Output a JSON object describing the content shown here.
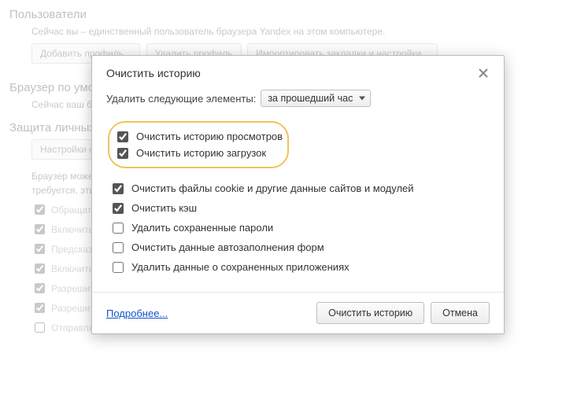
{
  "bg": {
    "users_heading": "Пользователи",
    "users_desc": "Сейчас вы – единственный пользователь браузера Yandex на этом компьютере.",
    "add_profile": "Добавить профиль...",
    "del_profile": "Удалить профиль",
    "import": "Импортировать закладки и настройки...",
    "default_heading": "Браузер по умолчанию",
    "default_desc": "Сейчас ваш бр",
    "privacy_heading": "Защита личных",
    "content_btn": "Настройки с",
    "privacy_desc1": "Браузер может",
    "privacy_desc2": "требуется, эти",
    "opts": [
      "Обращаться",
      "Включить п",
      "Предсказыв",
      "Включить з",
      "Разрешить с",
      "Разрешить отправлять в Яндекс отчёты о сбоях",
      "Отправлять сайтам запрос «Не отслеживать»"
    ]
  },
  "dialog": {
    "title": "Очистить историю",
    "delete_label": "Удалить следующие элементы:",
    "select_value": "за прошедший час",
    "options": [
      {
        "label": "Очистить историю просмотров",
        "checked": true
      },
      {
        "label": "Очистить историю загрузок",
        "checked": true
      },
      {
        "label": "Очистить файлы cookie и другие данные сайтов и модулей",
        "checked": true
      },
      {
        "label": "Очистить кэш",
        "checked": true
      },
      {
        "label": "Удалить сохраненные пароли",
        "checked": false
      },
      {
        "label": "Очистить данные автозаполнения форм",
        "checked": false
      },
      {
        "label": "Удалить данные о сохраненных приложениях",
        "checked": false
      }
    ],
    "more": "Подробнее...",
    "clear": "Очистить историю",
    "cancel": "Отмена"
  }
}
